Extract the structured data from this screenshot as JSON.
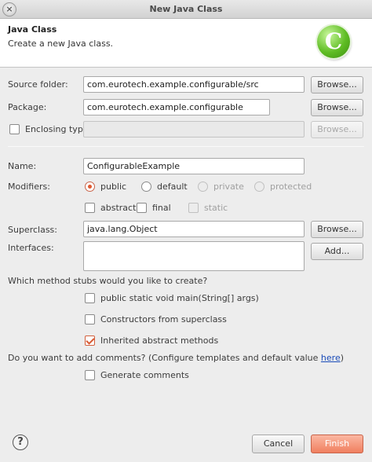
{
  "window": {
    "title": "New Java Class"
  },
  "banner": {
    "title": "Java Class",
    "description": "Create a new Java class."
  },
  "source_folder": {
    "label": "Source folder:",
    "value": "com.eurotech.example.configurable/src",
    "browse": "Browse..."
  },
  "package": {
    "label": "Package:",
    "value": "com.eurotech.example.configurable",
    "browse": "Browse..."
  },
  "enclosing": {
    "label": "Enclosing type:",
    "value": "",
    "browse": "Browse..."
  },
  "name": {
    "label": "Name:",
    "value": "ConfigurableExample"
  },
  "modifiers": {
    "label": "Modifiers:",
    "access": [
      "public",
      "default",
      "private",
      "protected"
    ],
    "selected": "public",
    "other": [
      "abstract",
      "final",
      "static"
    ]
  },
  "superclass": {
    "label": "Superclass:",
    "value": "java.lang.Object",
    "browse": "Browse..."
  },
  "interfaces": {
    "label": "Interfaces:",
    "add": "Add..."
  },
  "stubs": {
    "question": "Which method stubs would you like to create?",
    "main": "public static void main(String[] args)",
    "constructors": "Constructors from superclass",
    "inherited": "Inherited abstract methods"
  },
  "comments": {
    "question_prefix": "Do you want to add comments? (Configure templates and default value ",
    "link": "here",
    "question_suffix": ")",
    "generate": "Generate comments"
  },
  "footer": {
    "help": "?",
    "cancel": "Cancel",
    "finish": "Finish"
  },
  "colors": {
    "accent": "#e0592f",
    "finish_button": "#f07f5f",
    "logo": "#5fbd24"
  }
}
